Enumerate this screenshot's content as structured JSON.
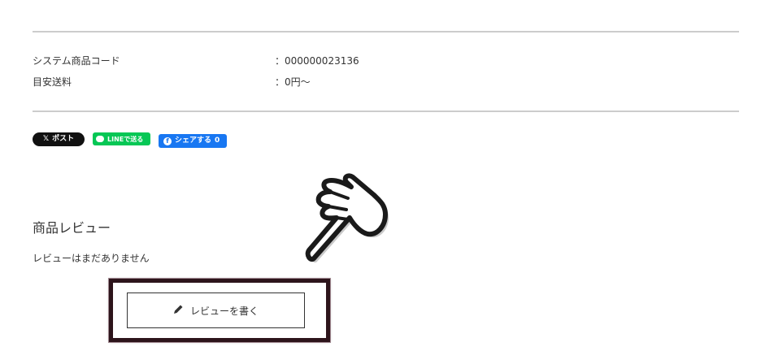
{
  "specs": [
    {
      "label": "システム商品コード",
      "value": "：000000023136"
    },
    {
      "label": "目安送料",
      "value": "：0円〜"
    }
  ],
  "social": {
    "x_label": "ポスト",
    "line_label": "LINEで送る",
    "fb_label": "シェアする",
    "fb_count": "0"
  },
  "reviews": {
    "title": "商品レビュー",
    "empty_text": "レビューはまだありません",
    "write_button_label": "レビューを書く"
  },
  "colors": {
    "x": "#111111",
    "line": "#06c755",
    "facebook": "#1877f2",
    "highlight_border": "#2d141b"
  },
  "icons": {
    "pencil": "pencil-icon",
    "pointing_hand": "pointing-hand-icon"
  }
}
